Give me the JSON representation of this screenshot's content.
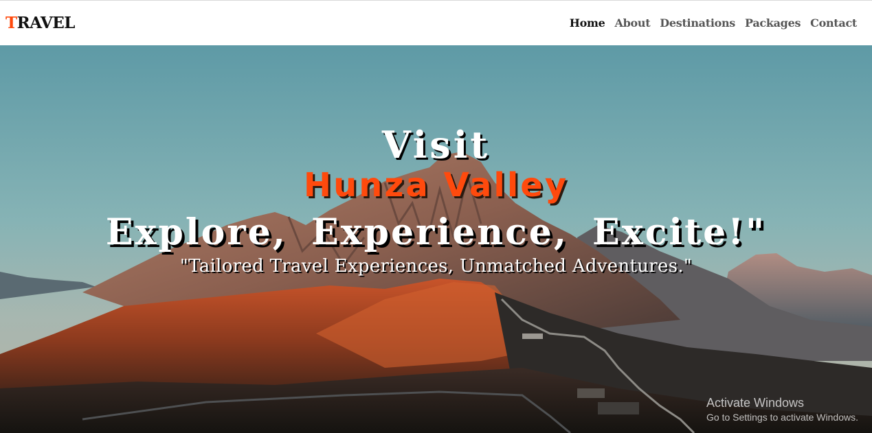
{
  "brand": {
    "first_letter": "T",
    "rest": "RAVEL",
    "accent_color": "#ff4a0d"
  },
  "nav": {
    "items": [
      {
        "label": "Home",
        "active": true
      },
      {
        "label": "About",
        "active": false
      },
      {
        "label": "Destinations",
        "active": false
      },
      {
        "label": "Packages",
        "active": false
      },
      {
        "label": "Contact",
        "active": false
      }
    ]
  },
  "hero": {
    "line1": "Visit",
    "destination": "Hunza Valley",
    "tagline": "Explore, Experience, Excite!\"",
    "subtitle": "\"Tailored Travel Experiences, Unmatched Adventures.\"",
    "background": "mountain-landscape-photo"
  },
  "watermark": {
    "title": "Activate Windows",
    "subtitle": "Go to Settings to activate Windows."
  }
}
